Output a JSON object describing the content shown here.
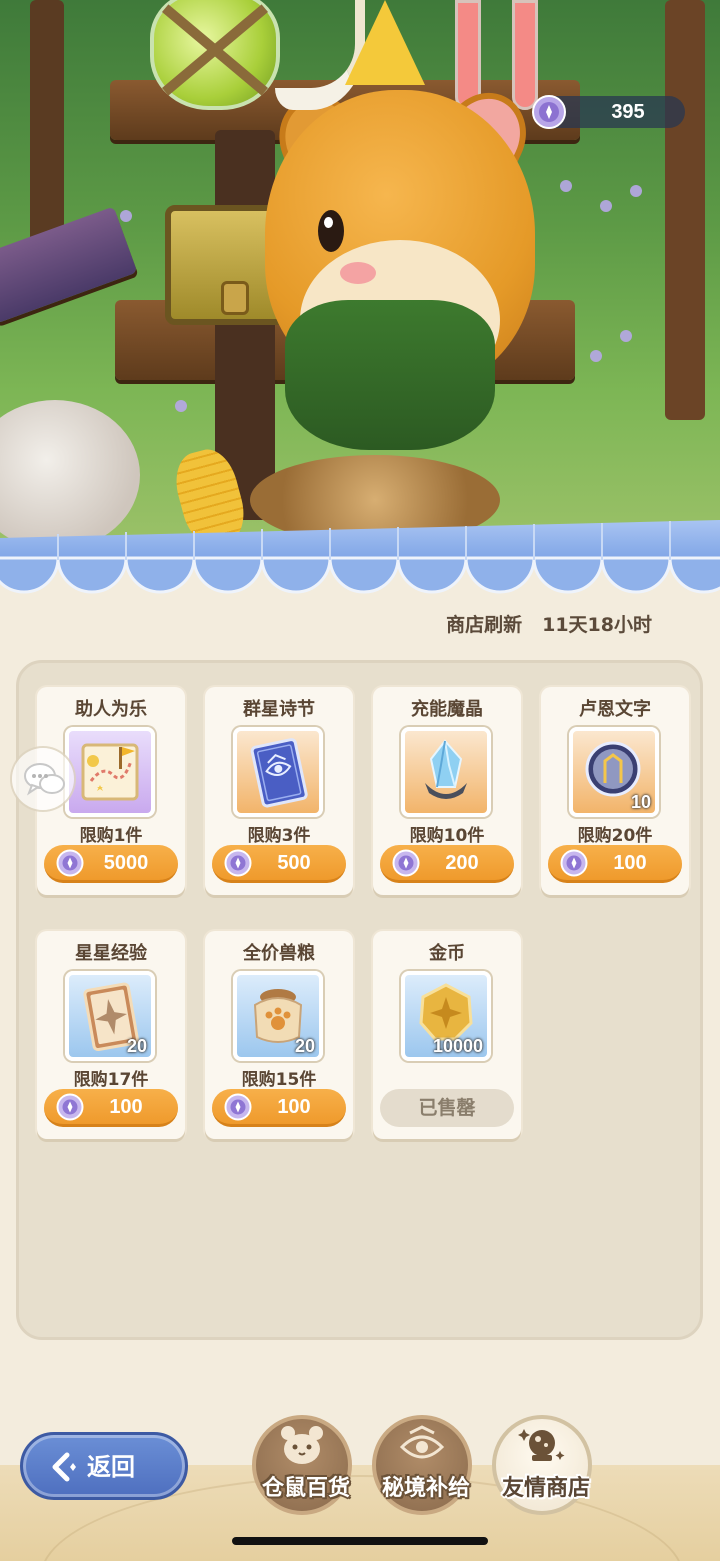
{
  "currency": {
    "amount": "395",
    "icon": "purple-coin-icon"
  },
  "refresh": {
    "label": "商店刷新",
    "time": "11天18小时"
  },
  "items": [
    {
      "title": "助人为乐",
      "limit": "限购1件",
      "price": "5000",
      "qty": "",
      "frame": "purple",
      "icon": "treasure-map-icon",
      "sold_out": false
    },
    {
      "title": "群星诗节",
      "limit": "限购3件",
      "price": "500",
      "qty": "",
      "frame": "orange",
      "icon": "star-card-icon",
      "sold_out": false
    },
    {
      "title": "充能魔晶",
      "limit": "限购10件",
      "price": "200",
      "qty": "",
      "frame": "orange",
      "icon": "crystal-icon",
      "sold_out": false
    },
    {
      "title": "卢恩文字",
      "limit": "限购20件",
      "price": "100",
      "qty": "10",
      "frame": "orange",
      "icon": "rune-orb-icon",
      "sold_out": false
    },
    {
      "title": "星星经验",
      "limit": "限购17件",
      "price": "100",
      "qty": "20",
      "frame": "blue",
      "icon": "exp-card-icon",
      "sold_out": false
    },
    {
      "title": "全价兽粮",
      "limit": "限购15件",
      "price": "100",
      "qty": "20",
      "frame": "blue",
      "icon": "food-bag-icon",
      "sold_out": false
    },
    {
      "title": "金币",
      "limit": "",
      "price": "",
      "qty": "10000",
      "frame": "blue",
      "icon": "gold-coin-icon",
      "sold_out": true,
      "sold_label": "已售罄"
    }
  ],
  "back": {
    "label": "返回"
  },
  "tabs": [
    {
      "label": "仓鼠百货",
      "icon": "hamster-face-icon",
      "active": false
    },
    {
      "label": "秘境补给",
      "icon": "eye-emblem-icon",
      "active": false
    },
    {
      "label": "友情商店",
      "icon": "crystal-ball-icon",
      "active": true
    }
  ],
  "colors": {
    "accent": "#ef9a2c",
    "panel": "#e7dfcd",
    "back_button": "#4e6fbf"
  }
}
